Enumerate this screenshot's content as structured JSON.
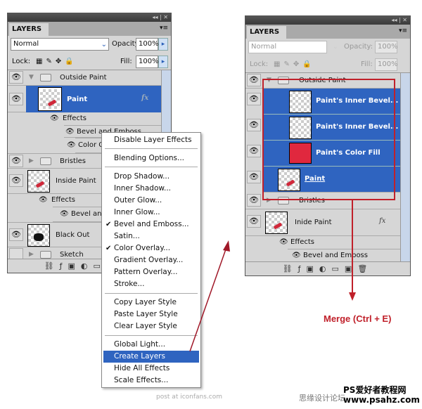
{
  "left_panel": {
    "tab": "LAYERS",
    "blend_mode": "Normal",
    "opacity_label": "Opacity:",
    "opacity": "100%",
    "lock_label": "Lock:",
    "fill_label": "Fill:",
    "fill": "100%",
    "layers": {
      "outside_paint": "Outside Paint",
      "paint": "Paint",
      "fx": "fx",
      "effects": "Effects",
      "bevel": "Bevel and Emboss",
      "color_overlay": "Color Overlay",
      "bristles": "Bristles",
      "inside_paint": "Inside Paint",
      "effects2": "Effects",
      "bevel2": "Bevel and E",
      "black_out": "Black Out",
      "sketch": "Sketch"
    }
  },
  "context_menu": {
    "items": [
      "Disable Layer Effects",
      "Blending Options...",
      "Drop Shadow...",
      "Inner Shadow...",
      "Outer Glow...",
      "Inner Glow...",
      "Bevel and Emboss...",
      "Satin...",
      "Color Overlay...",
      "Gradient Overlay...",
      "Pattern Overlay...",
      "Stroke...",
      "Copy Layer Style",
      "Paste Layer Style",
      "Clear Layer Style",
      "Global Light...",
      "Create Layers",
      "Hide All Effects",
      "Scale Effects..."
    ],
    "checked": [
      "Bevel and Emboss...",
      "Color Overlay..."
    ],
    "highlighted": "Create Layers"
  },
  "right_panel": {
    "tab": "LAYERS",
    "blend_mode": "Normal",
    "opacity_label": "Opacity:",
    "opacity": "100%",
    "lock_label": "Lock:",
    "fill_label": "Fill:",
    "fill": "100%",
    "layers": {
      "outside_paint": "Outside Paint",
      "inner_bevel_1": "Paint's Inner Bevel...",
      "inner_bevel_2": "Paint's Inner Bevel...",
      "color_fill": "Paint's Color Fill",
      "paint": "Paint",
      "bristles": "Bristles",
      "inide_paint": "Inide Paint",
      "fx": "fx",
      "effects": "Effects",
      "bevel": "Bevel and Emboss"
    }
  },
  "annotation": {
    "merge": "Merge (Ctrl + E)"
  },
  "colors": {
    "selection": "#2f64c0",
    "annotation_red": "#c0202a",
    "color_fill": "#e0283e"
  },
  "watermarks": {
    "post": "post at iconfans.com",
    "cn1": "思缘设计论坛",
    "cn2": "PS爱好者教程网",
    "site": "www.psahz.com"
  }
}
